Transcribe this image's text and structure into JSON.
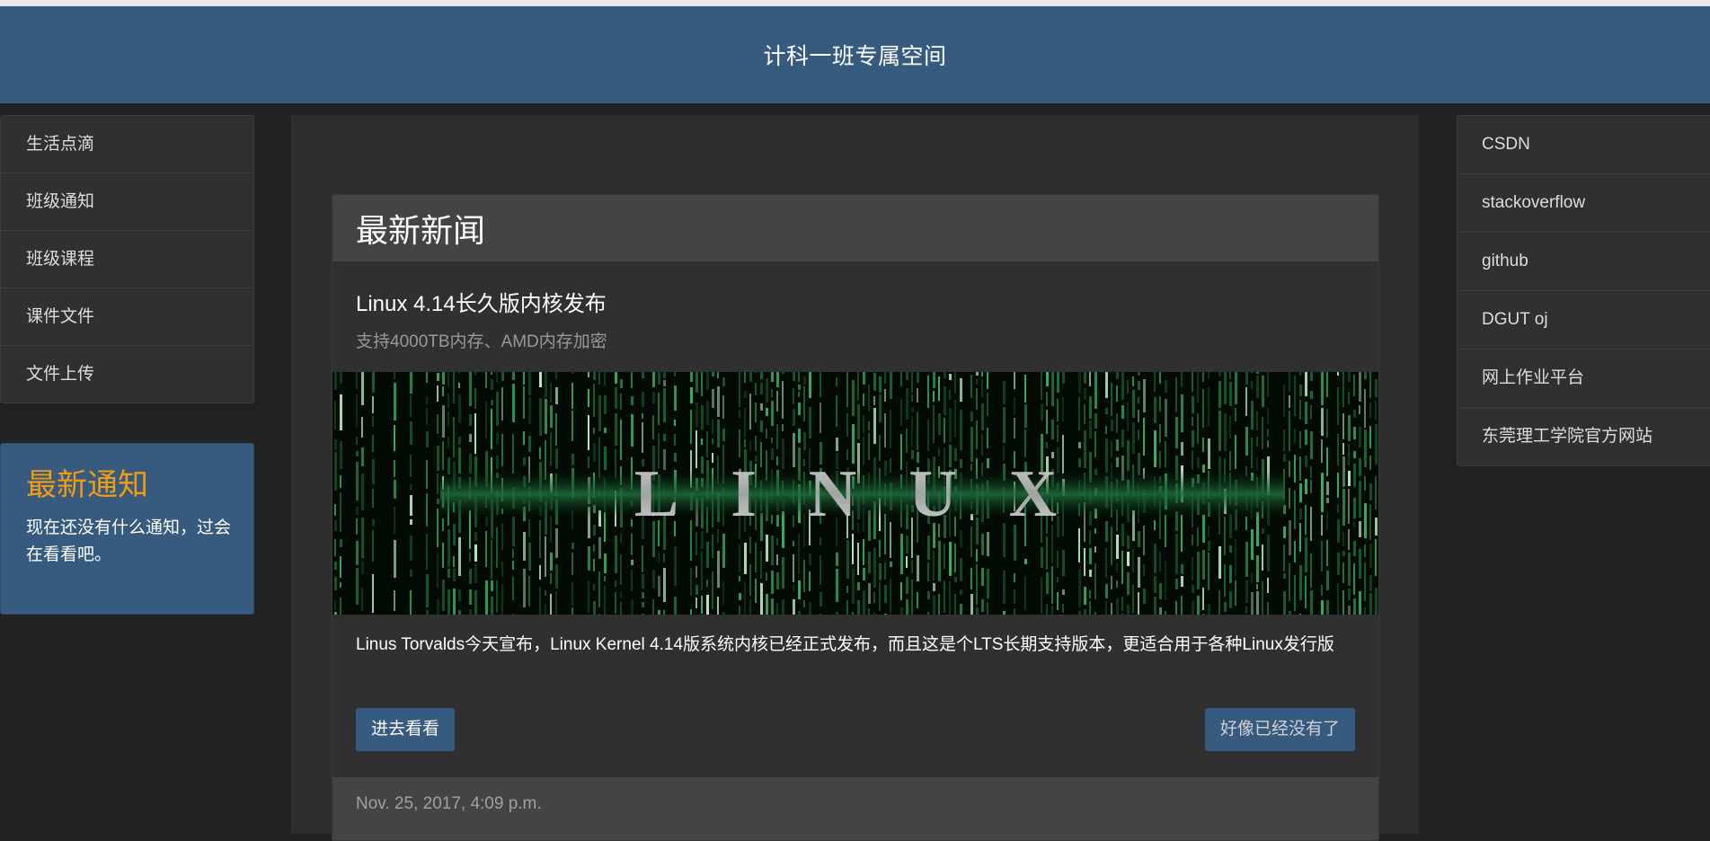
{
  "header": {
    "title": "计科一班专属空间"
  },
  "left_nav": {
    "items": [
      {
        "label": "生活点滴"
      },
      {
        "label": "班级通知"
      },
      {
        "label": "班级课程"
      },
      {
        "label": "课件文件"
      },
      {
        "label": "文件上传"
      }
    ]
  },
  "notice": {
    "title": "最新通知",
    "text": "现在还没有什么通知，过会在看看吧。"
  },
  "news": {
    "section_title": "最新新闻",
    "title": "Linux 4.14长久版内核发布",
    "subtitle": "支持4000TB内存、AMD内存加密",
    "image_text": "LINUX",
    "description": "Linus Torvalds今天宣布，Linux Kernel 4.14版系统内核已经正式发布，而且这是个LTS长期支持版本，更适合用于各种Linux发行版",
    "enter_button": "进去看看",
    "none_button": "好像已经没有了",
    "timestamp": "Nov. 25, 2017, 4:09 p.m."
  },
  "right_nav": {
    "links": [
      {
        "label": "CSDN"
      },
      {
        "label": "stackoverflow"
      },
      {
        "label": "github"
      },
      {
        "label": "DGUT oj"
      },
      {
        "label": "网上作业平台"
      },
      {
        "label": "东莞理工学院官方网站"
      }
    ]
  },
  "colors": {
    "header_bg": "#375a7f",
    "page_bg": "#222222",
    "notice_title": "#f39c12"
  }
}
